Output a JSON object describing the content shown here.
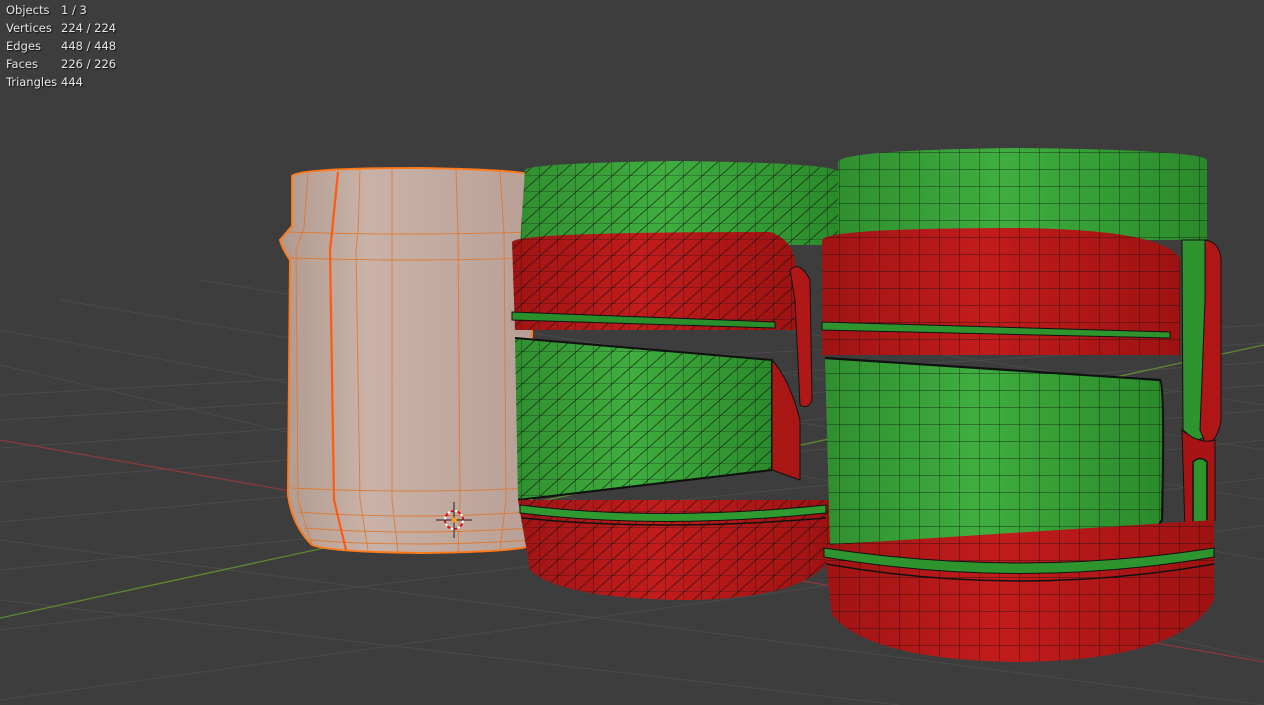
{
  "viewport": {
    "background": "#3d3d3d",
    "grid_color": "#4a4a4a",
    "x_axis_color": "#8b3a3a",
    "y_axis_color": "#5d8a2e",
    "selection_color": "#ff7a1a",
    "face_color_green": "#3aa63a",
    "face_color_red": "#b81818",
    "unselected_mesh_color": "#c4aba0"
  },
  "stats": [
    {
      "label": "Objects",
      "value": "1 / 3"
    },
    {
      "label": "Vertices",
      "value": "224 / 224"
    },
    {
      "label": "Edges",
      "value": "448 / 448"
    },
    {
      "label": "Faces",
      "value": "226 / 226"
    },
    {
      "label": "Triangles",
      "value": "444"
    }
  ]
}
